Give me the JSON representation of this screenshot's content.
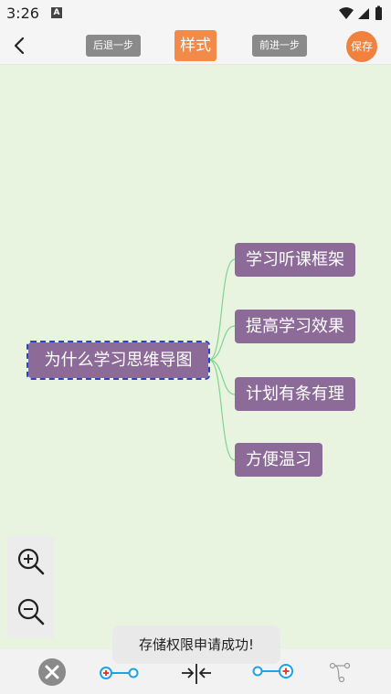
{
  "status_bar": {
    "time": "3:26",
    "notification_letter": "A"
  },
  "toolbar": {
    "undo_label": "后退一步",
    "style_label": "样式",
    "redo_label": "前进一步",
    "save_label": "保存"
  },
  "mindmap": {
    "root": "为什么学习思维导图",
    "children": [
      "学习听课框架",
      "提高学习效果",
      "计划有条有理",
      "方便温习"
    ]
  },
  "toast": {
    "message": "存储权限申请成功!"
  },
  "colors": {
    "accent": "#f0813f",
    "node": "#8d6b98",
    "canvas": "#e8f3e0",
    "connector": "#7fd48e",
    "selection": "#2a43c9",
    "tool_blue": "#1aa3e8",
    "tool_red": "#e83c3c"
  },
  "icons": {
    "back": "chevron-left-icon",
    "zoom_in": "zoom-in-icon",
    "zoom_out": "zoom-out-icon",
    "delete": "close-circle-icon",
    "add_child": "add-child-node-icon",
    "collapse": "collapse-icon",
    "add_sibling": "add-sibling-node-icon",
    "layout": "connector-style-icon"
  }
}
